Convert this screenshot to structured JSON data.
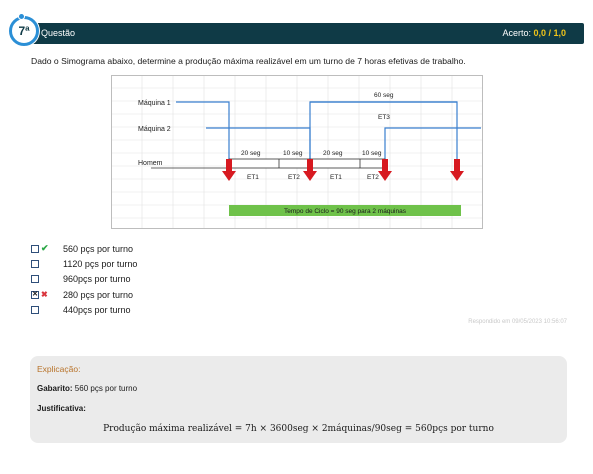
{
  "header": {
    "number": "7ª",
    "label": "Questão",
    "score_prefix": "Acerto:",
    "score_value": "0,0 / 1,0"
  },
  "question": "Dado o Simograma abaixo, determine a produção máxima realizável em um turno de 7 horas efetivas de trabalho.",
  "figure": {
    "labels": {
      "m1": "Máquina 1",
      "m2": "Máquina 2",
      "homem": "Homem",
      "top_time": "60 seg",
      "et3": "ET3",
      "seg1": "20 seg",
      "seg2": "10 seg",
      "seg3": "20 seg",
      "seg4": "10 seg",
      "et1a": "ET1",
      "et2a": "ET2",
      "et1b": "ET1",
      "et2b": "ET2",
      "cycle": "Tempo de Ciclo = 90 seg para 2 máquinas"
    },
    "colors": {
      "blue_line": "#3a7fcf",
      "arrow": "#d71920",
      "cycle_box": "#6fc24a",
      "grid": "#d9d9d9"
    }
  },
  "options": [
    {
      "text": "560 pçs por turno",
      "checked": false,
      "mark": "correct"
    },
    {
      "text": "1120 pçs por turno",
      "checked": false,
      "mark": ""
    },
    {
      "text": "960pçs por turno",
      "checked": false,
      "mark": ""
    },
    {
      "text": "280 pçs por turno",
      "checked": true,
      "mark": "wrong"
    },
    {
      "text": "440pçs por turno",
      "checked": false,
      "mark": ""
    }
  ],
  "answered_at": "Respondido em 09/05/2023 10:56:07",
  "explanation": {
    "title": "Explicação:",
    "gabarito_label": "Gabarito:",
    "gabarito_value": "560 pçs por turno",
    "justificativa_label": "Justificativa:",
    "formula": "Produção máxima realizável = 7h × 3600seg × 2máquinas/90seg = 560pçs por turno"
  }
}
